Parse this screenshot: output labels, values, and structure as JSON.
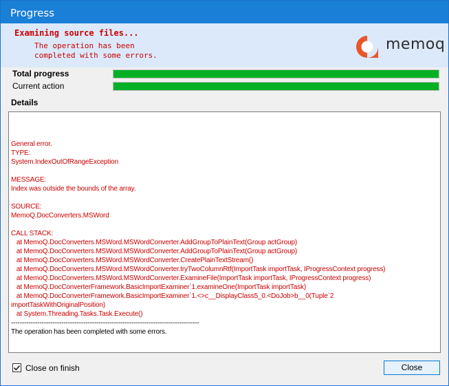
{
  "window": {
    "title": "Progress"
  },
  "header": {
    "status_title": "Examining source files...",
    "status_message": "The operation has been completed with some errors.",
    "logo_text": "memoq"
  },
  "progress": {
    "total_label": "Total progress",
    "total_value": 1.0,
    "current_label": "Current action",
    "current_value": 1.0,
    "bar_color": "#06b025"
  },
  "details": {
    "label": "Details",
    "lines": [
      {
        "text": "",
        "color": "red"
      },
      {
        "text": "General error.",
        "color": "red"
      },
      {
        "text": "TYPE:",
        "color": "red"
      },
      {
        "text": "System.IndexOutOfRangeException",
        "color": "red"
      },
      {
        "text": "",
        "color": "red"
      },
      {
        "text": "MESSAGE:",
        "color": "red"
      },
      {
        "text": "Index was outside the bounds of the array.",
        "color": "red"
      },
      {
        "text": "",
        "color": "red"
      },
      {
        "text": "SOURCE:",
        "color": "red"
      },
      {
        "text": "MemoQ.DocConverters.MSWord",
        "color": "red"
      },
      {
        "text": "",
        "color": "red"
      },
      {
        "text": "CALL STACK:",
        "color": "red"
      },
      {
        "text": "   at MemoQ.DocConverters.MSWord.MSWordConverter.AddGroupToPlainText(Group actGroup)",
        "color": "red"
      },
      {
        "text": "   at MemoQ.DocConverters.MSWord.MSWordConverter.AddGroupToPlainText(Group actGroup)",
        "color": "red"
      },
      {
        "text": "   at MemoQ.DocConverters.MSWord.MSWordConverter.CreatePlainTextStream()",
        "color": "red"
      },
      {
        "text": "   at MemoQ.DocConverters.MSWord.MSWordConverter.tryTwoColumnRtf(ImportTask importTask, IProgressContext progress)",
        "color": "red"
      },
      {
        "text": "   at MemoQ.DocConverters.MSWord.MSWordConverter.ExamineFile(ImportTask importTask, IProgressContext progress)",
        "color": "red"
      },
      {
        "text": "   at MemoQ.DocConverterFramework.BasicImportExaminer`1.examineOne(ImportTask importTask)",
        "color": "red"
      },
      {
        "text": "   at MemoQ.DocConverterFramework.BasicImportExaminer`1.<>c__DisplayClass5_0.<DoJob>b__0(Tuple`2",
        "color": "red"
      },
      {
        "text": "importTaskWithOriginalPosition)",
        "color": "red"
      },
      {
        "text": "   at System.Threading.Tasks.Task.Execute()",
        "color": "red"
      },
      {
        "text": "--------------------------------------------------------------------------------------",
        "color": "black"
      },
      {
        "text": "The operation has been completed with some errors.",
        "color": "black"
      }
    ]
  },
  "footer": {
    "close_on_finish_label": "Close on finish",
    "close_on_finish_checked": true,
    "close_button_label": "Close"
  },
  "colors": {
    "title_bar": "#1a7fd6",
    "error_text": "#cc0000",
    "logo_orange": "#e8562a"
  }
}
